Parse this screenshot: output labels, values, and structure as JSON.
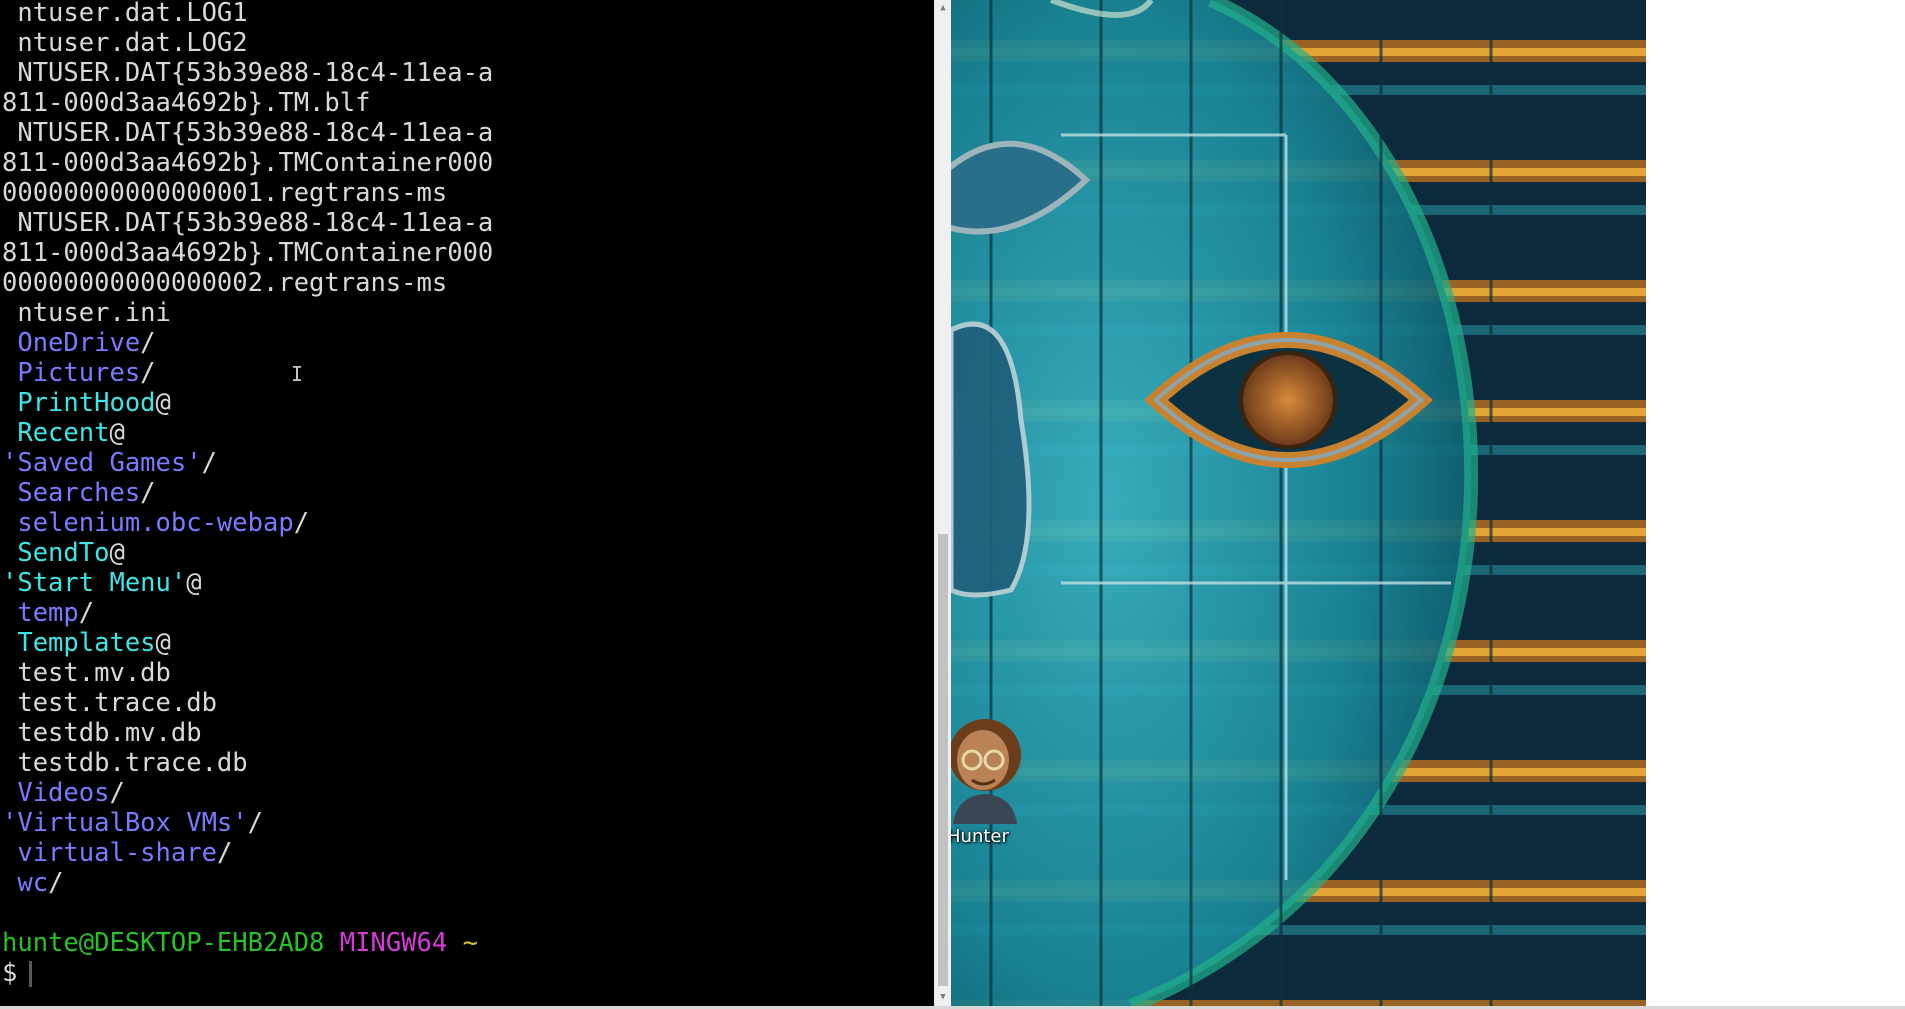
{
  "terminal": {
    "lines": [
      {
        "segments": [
          {
            "text": " ntuser.dat.LOG1",
            "cls": "c-def"
          }
        ]
      },
      {
        "segments": [
          {
            "text": " ntuser.dat.LOG2",
            "cls": "c-def"
          }
        ]
      },
      {
        "segments": [
          {
            "text": " NTUSER.DAT{53b39e88-18c4-11ea-a",
            "cls": "c-def"
          }
        ]
      },
      {
        "segments": [
          {
            "text": "811-000d3aa4692b}.TM.blf",
            "cls": "c-def"
          }
        ]
      },
      {
        "segments": [
          {
            "text": " NTUSER.DAT{53b39e88-18c4-11ea-a",
            "cls": "c-def"
          }
        ]
      },
      {
        "segments": [
          {
            "text": "811-000d3aa4692b}.TMContainer000",
            "cls": "c-def"
          }
        ]
      },
      {
        "segments": [
          {
            "text": "00000000000000001.regtrans-ms",
            "cls": "c-def"
          }
        ]
      },
      {
        "segments": [
          {
            "text": " NTUSER.DAT{53b39e88-18c4-11ea-a",
            "cls": "c-def"
          }
        ]
      },
      {
        "segments": [
          {
            "text": "811-000d3aa4692b}.TMContainer000",
            "cls": "c-def"
          }
        ]
      },
      {
        "segments": [
          {
            "text": "00000000000000002.regtrans-ms",
            "cls": "c-def"
          }
        ]
      },
      {
        "segments": [
          {
            "text": " ntuser.ini",
            "cls": "c-def"
          }
        ]
      },
      {
        "segments": [
          {
            "text": " OneDrive",
            "cls": "c-dir"
          },
          {
            "text": "/",
            "cls": "c-def"
          }
        ]
      },
      {
        "segments": [
          {
            "text": " Pictures",
            "cls": "c-dir"
          },
          {
            "text": "/",
            "cls": "c-def"
          }
        ]
      },
      {
        "segments": [
          {
            "text": " PrintHood",
            "cls": "c-link"
          },
          {
            "text": "@",
            "cls": "c-def"
          }
        ]
      },
      {
        "segments": [
          {
            "text": " Recent",
            "cls": "c-link"
          },
          {
            "text": "@",
            "cls": "c-def"
          }
        ]
      },
      {
        "segments": [
          {
            "text": "'Saved Games'",
            "cls": "c-dir"
          },
          {
            "text": "/",
            "cls": "c-def"
          }
        ]
      },
      {
        "segments": [
          {
            "text": " Searches",
            "cls": "c-dir"
          },
          {
            "text": "/",
            "cls": "c-def"
          }
        ]
      },
      {
        "segments": [
          {
            "text": " selenium.obc-webap",
            "cls": "c-dir"
          },
          {
            "text": "/",
            "cls": "c-def"
          }
        ]
      },
      {
        "segments": [
          {
            "text": " SendTo",
            "cls": "c-link"
          },
          {
            "text": "@",
            "cls": "c-def"
          }
        ]
      },
      {
        "segments": [
          {
            "text": "'Start Menu'",
            "cls": "c-link"
          },
          {
            "text": "@",
            "cls": "c-def"
          }
        ]
      },
      {
        "segments": [
          {
            "text": " temp",
            "cls": "c-dir"
          },
          {
            "text": "/",
            "cls": "c-def"
          }
        ]
      },
      {
        "segments": [
          {
            "text": " Templates",
            "cls": "c-link"
          },
          {
            "text": "@",
            "cls": "c-def"
          }
        ]
      },
      {
        "segments": [
          {
            "text": " test.mv.db",
            "cls": "c-def"
          }
        ]
      },
      {
        "segments": [
          {
            "text": " test.trace.db",
            "cls": "c-def"
          }
        ]
      },
      {
        "segments": [
          {
            "text": " testdb.mv.db",
            "cls": "c-def"
          }
        ]
      },
      {
        "segments": [
          {
            "text": " testdb.trace.db",
            "cls": "c-def"
          }
        ]
      },
      {
        "segments": [
          {
            "text": " Videos",
            "cls": "c-dir"
          },
          {
            "text": "/",
            "cls": "c-def"
          }
        ]
      },
      {
        "segments": [
          {
            "text": "'VirtualBox VMs'",
            "cls": "c-dir"
          },
          {
            "text": "/",
            "cls": "c-def"
          }
        ]
      },
      {
        "segments": [
          {
            "text": " virtual-share",
            "cls": "c-dir"
          },
          {
            "text": "/",
            "cls": "c-def"
          }
        ]
      },
      {
        "segments": [
          {
            "text": " wc",
            "cls": "c-dir"
          },
          {
            "text": "/",
            "cls": "c-def"
          }
        ]
      },
      {
        "segments": []
      },
      {
        "segments": [
          {
            "text": "hunte@DESKTOP-EHB2AD8",
            "cls": "c-user"
          },
          {
            "text": " ",
            "cls": "c-def"
          },
          {
            "text": "MINGW64",
            "cls": "c-sys"
          },
          {
            "text": " ",
            "cls": "c-def"
          },
          {
            "text": "~",
            "cls": "c-path"
          }
        ]
      },
      {
        "segments": [
          {
            "text": "$",
            "cls": "c-def"
          }
        ],
        "cursor": true
      }
    ]
  },
  "desktop": {
    "icon_label": "Hunter",
    "icon_name": "user-avatar-icon"
  },
  "colors": {
    "terminal_bg": "#000000",
    "default_text": "#d9d9d9",
    "directory": "#7a7aff",
    "symlink": "#3de5e5",
    "prompt_user": "#27c227",
    "prompt_system": "#d73bd7",
    "prompt_path": "#d1c43a"
  }
}
